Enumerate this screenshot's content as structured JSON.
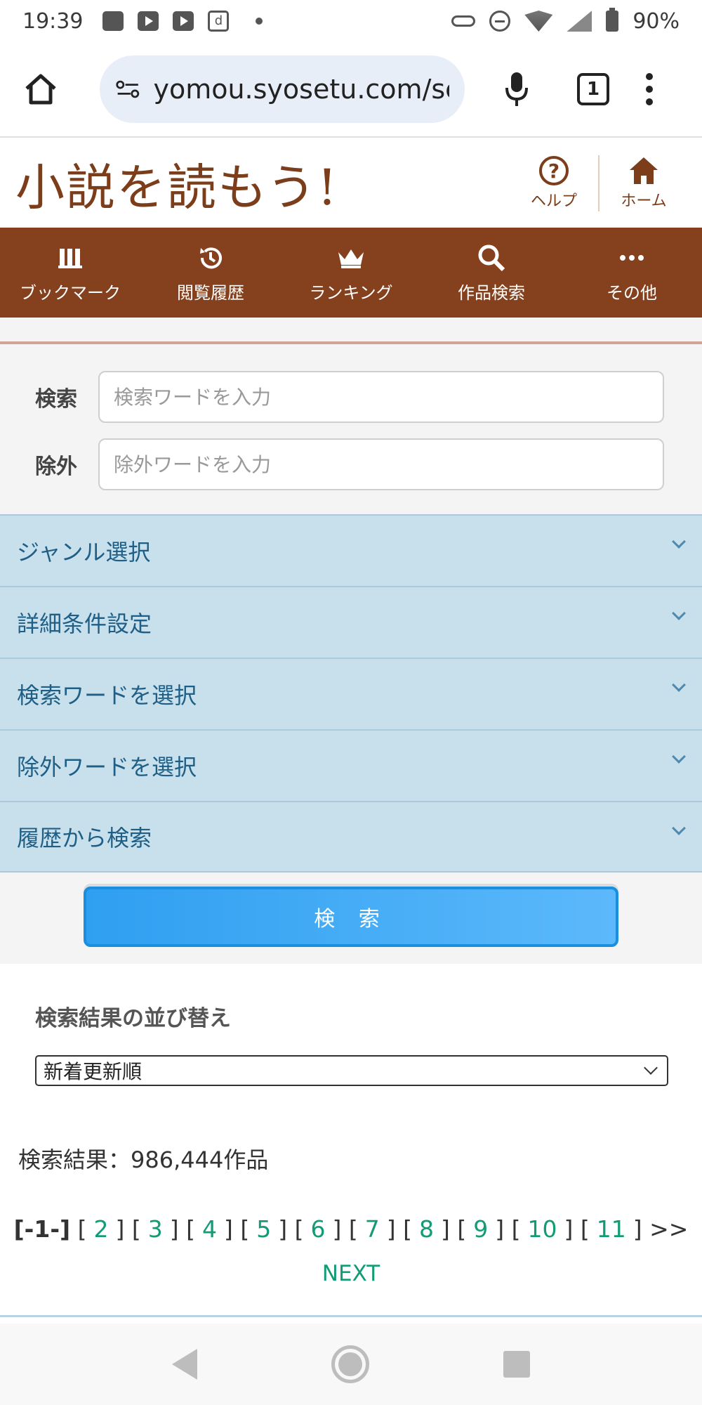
{
  "status_bar": {
    "time": "19:39",
    "battery": "90%"
  },
  "browser": {
    "url": "yomou.syosetu.com/sea",
    "tab_count": "1"
  },
  "site": {
    "logo": "小説を読もう!",
    "help_label": "ヘルプ",
    "home_label": "ホーム"
  },
  "nav": {
    "items": [
      {
        "label": "ブックマーク",
        "icon": "bookshelf-icon"
      },
      {
        "label": "閲覧履歴",
        "icon": "history-icon"
      },
      {
        "label": "ランキング",
        "icon": "crown-icon"
      },
      {
        "label": "作品検索",
        "icon": "search-icon"
      },
      {
        "label": "その他",
        "icon": "more-icon"
      }
    ]
  },
  "search": {
    "keyword_label": "検索",
    "keyword_placeholder": "検索ワードを入力",
    "exclude_label": "除外",
    "exclude_placeholder": "除外ワードを入力",
    "accordions": [
      "ジャンル選択",
      "詳細条件設定",
      "検索ワードを選択",
      "除外ワードを選択",
      "履歴から検索"
    ],
    "submit_label": "検 索"
  },
  "sort": {
    "title": "検索結果の並び替え",
    "selected": "新着更新順"
  },
  "results": {
    "count_text": "検索結果：986,444作品"
  },
  "pager": {
    "current": "[-1-]",
    "pages": [
      "2",
      "3",
      "4",
      "5",
      "6",
      "7",
      "8",
      "9",
      "10",
      "11"
    ],
    "more": ">>",
    "next": "NEXT"
  }
}
